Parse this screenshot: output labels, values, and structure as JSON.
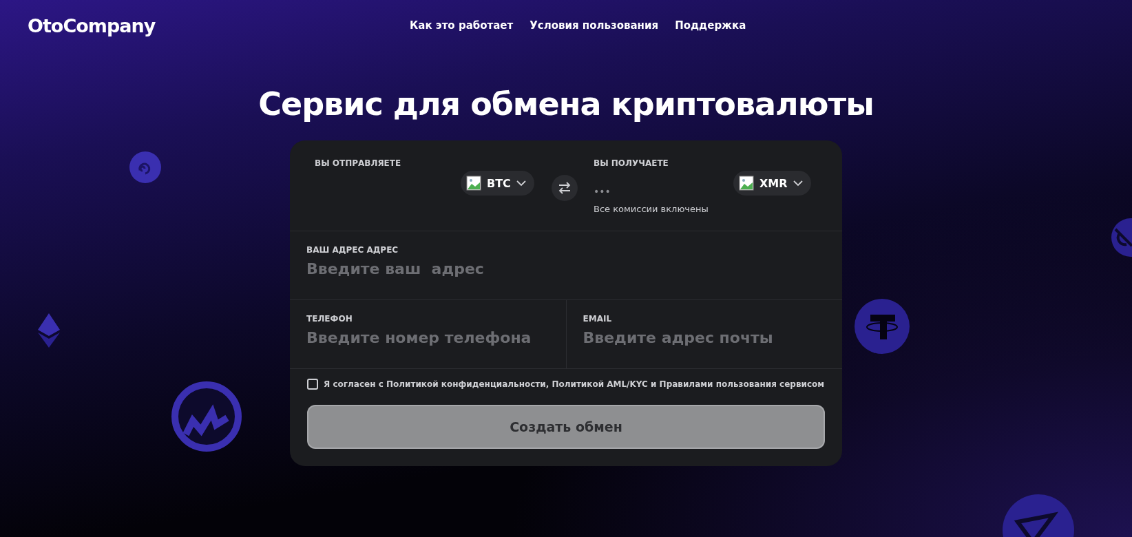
{
  "header": {
    "logo": "OtoCompany",
    "nav": [
      {
        "label": "Как это работает"
      },
      {
        "label": "Условия пользования"
      },
      {
        "label": "Поддержка"
      }
    ]
  },
  "title": "Сервис для обмена криптовалюты",
  "exchange": {
    "send": {
      "label": "ВЫ ОТПРАВЛЯЕТЕ",
      "currency": "BTC"
    },
    "receive": {
      "label": "ВЫ ПОЛУЧАЕТЕ",
      "amount": "•••",
      "note": "Все комиссии включены",
      "currency": "XMR"
    }
  },
  "fields": [
    {
      "label": "ВАШ АДРЕС АДРЕС",
      "placeholder": "Введите ваш  адрес"
    },
    {
      "label": "ТЕЛЕФОН",
      "placeholder": "Введите номер телефона"
    },
    {
      "label": "EMAIL",
      "placeholder": "Введите адрес почты"
    }
  ],
  "agreement": {
    "checked": false,
    "text": "Я согласен с Политикой конфиденциальности, Политикой AML/KYC  и Правилами пользования сервисом"
  },
  "submit": {
    "label": "Создать обмен",
    "disabled": true
  }
}
